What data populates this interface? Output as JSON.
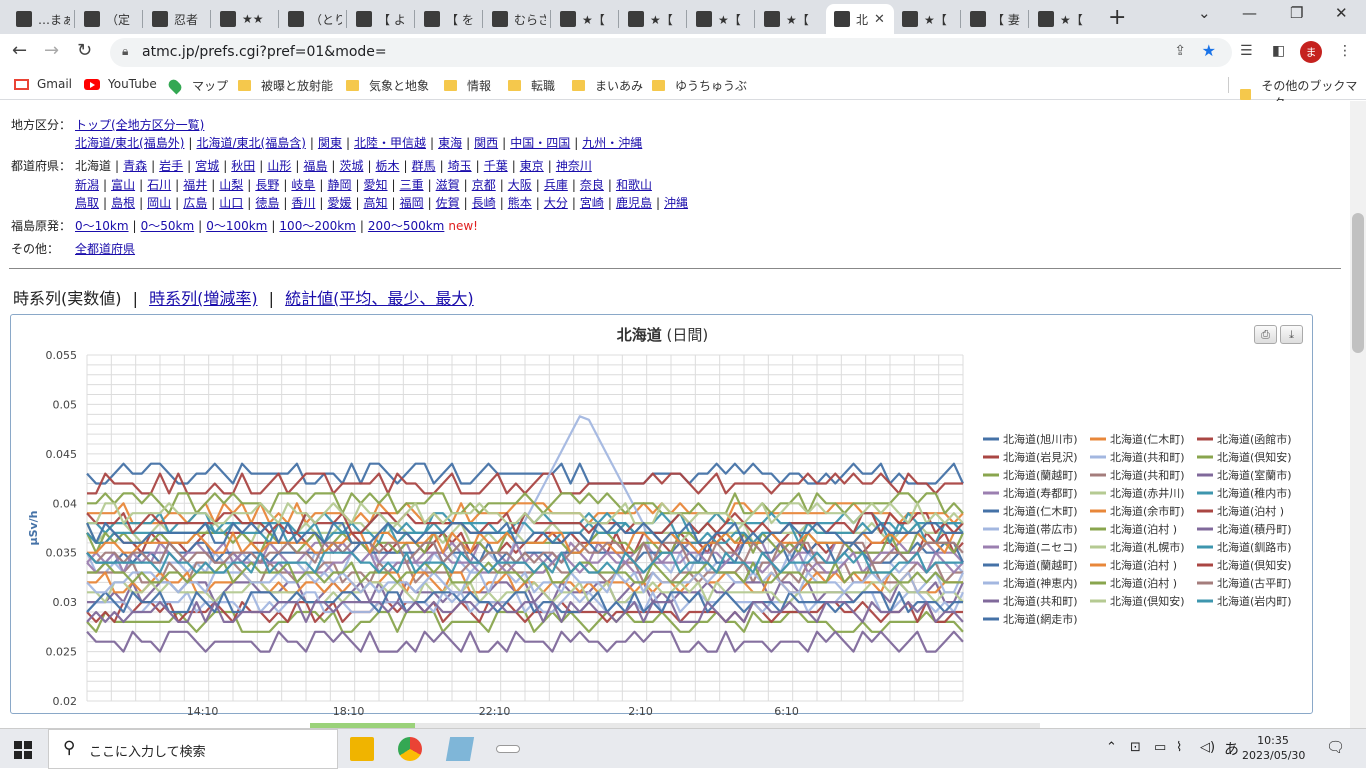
{
  "browser": {
    "tabs": [
      {
        "label": "…まぁ",
        "active": false
      },
      {
        "label": "（定",
        "active": false
      },
      {
        "label": "忍者",
        "active": false
      },
      {
        "label": "★★",
        "active": false
      },
      {
        "label": "（とり",
        "active": false
      },
      {
        "label": "【 よ",
        "active": false
      },
      {
        "label": "【 を",
        "active": false
      },
      {
        "label": "むらさ",
        "active": false
      },
      {
        "label": "★【",
        "active": false
      },
      {
        "label": "★【",
        "active": false
      },
      {
        "label": "★【",
        "active": false
      },
      {
        "label": "★【",
        "active": false
      },
      {
        "label": "北",
        "active": true
      },
      {
        "label": "★【",
        "active": false
      },
      {
        "label": "【 妻",
        "active": false
      },
      {
        "label": "★【",
        "active": false
      }
    ],
    "url": "atmc.jp/prefs.cgi?pref=01&mode=",
    "avatar_initial": "ま",
    "bookmarks": [
      "Gmail",
      "YouTube",
      "マップ",
      "被曝と放射能",
      "気象と地象",
      "情報",
      "転職",
      "まいあみ",
      "ゆうちゅうぶ"
    ],
    "other_bookmarks": "その他のブックマーク"
  },
  "page": {
    "nav": [
      {
        "label": "地方区分：",
        "lines": [
          [
            {
              "text": "トップ(全地方区分一覧)",
              "link": true
            }
          ],
          [
            {
              "text": "北海道/東北(福島外)",
              "link": true
            },
            {
              "text": "北海道/東北(福島含)",
              "link": true
            },
            {
              "text": "関東",
              "link": true
            },
            {
              "text": "北陸・甲信越",
              "link": true
            },
            {
              "text": "東海",
              "link": true
            },
            {
              "text": "関西",
              "link": true
            },
            {
              "text": "中国・四国",
              "link": true
            },
            {
              "text": "九州・沖縄",
              "link": true
            }
          ]
        ]
      },
      {
        "label": "都道府県：",
        "lines": [
          [
            {
              "text": "北海道",
              "link": false
            },
            {
              "text": "青森",
              "link": true
            },
            {
              "text": "岩手",
              "link": true
            },
            {
              "text": "宮城",
              "link": true
            },
            {
              "text": "秋田",
              "link": true
            },
            {
              "text": "山形",
              "link": true
            },
            {
              "text": "福島",
              "link": true
            },
            {
              "text": "茨城",
              "link": true
            },
            {
              "text": "栃木",
              "link": true
            },
            {
              "text": "群馬",
              "link": true
            },
            {
              "text": "埼玉",
              "link": true
            },
            {
              "text": "千葉",
              "link": true
            },
            {
              "text": "東京",
              "link": true
            },
            {
              "text": "神奈川",
              "link": true
            }
          ],
          [
            {
              "text": "新潟",
              "link": true
            },
            {
              "text": "富山",
              "link": true
            },
            {
              "text": "石川",
              "link": true
            },
            {
              "text": "福井",
              "link": true
            },
            {
              "text": "山梨",
              "link": true
            },
            {
              "text": "長野",
              "link": true
            },
            {
              "text": "岐阜",
              "link": true
            },
            {
              "text": "静岡",
              "link": true
            },
            {
              "text": "愛知",
              "link": true
            },
            {
              "text": "三重",
              "link": true
            },
            {
              "text": "滋賀",
              "link": true
            },
            {
              "text": "京都",
              "link": true
            },
            {
              "text": "大阪",
              "link": true
            },
            {
              "text": "兵庫",
              "link": true
            },
            {
              "text": "奈良",
              "link": true
            },
            {
              "text": "和歌山",
              "link": true
            }
          ],
          [
            {
              "text": "鳥取",
              "link": true
            },
            {
              "text": "島根",
              "link": true
            },
            {
              "text": "岡山",
              "link": true
            },
            {
              "text": "広島",
              "link": true
            },
            {
              "text": "山口",
              "link": true
            },
            {
              "text": "徳島",
              "link": true
            },
            {
              "text": "香川",
              "link": true
            },
            {
              "text": "愛媛",
              "link": true
            },
            {
              "text": "高知",
              "link": true
            },
            {
              "text": "福岡",
              "link": true
            },
            {
              "text": "佐賀",
              "link": true
            },
            {
              "text": "長崎",
              "link": true
            },
            {
              "text": "熊本",
              "link": true
            },
            {
              "text": "大分",
              "link": true
            },
            {
              "text": "宮崎",
              "link": true
            },
            {
              "text": "鹿児島",
              "link": true
            },
            {
              "text": "沖縄",
              "link": true
            }
          ]
        ]
      },
      {
        "label": "福島原発：",
        "lines": [
          [
            {
              "text": "0〜10km",
              "link": true
            },
            {
              "text": "0〜50km",
              "link": true
            },
            {
              "text": "0〜100km",
              "link": true
            },
            {
              "text": "100〜200km",
              "link": true
            },
            {
              "text": "200〜500km",
              "link": true
            }
          ]
        ],
        "new_label": "new!"
      },
      {
        "label": "その他：",
        "lines": [
          [
            {
              "text": "全都道府県",
              "link": true
            }
          ]
        ]
      }
    ],
    "views": {
      "current": "時系列(実数値)",
      "sep": "|",
      "link1": "時系列(増減率)",
      "link2": "統計値(平均、最少、最大)"
    }
  },
  "chart_data": {
    "type": "line",
    "title": "北海道",
    "subtitle": "(日間)",
    "ylabel": "μSv/h",
    "ylim": [
      0.02,
      0.055
    ],
    "yticks": [
      "0.055",
      "0.05",
      "0.045",
      "0.04",
      "0.035",
      "0.03",
      "0.025",
      "0.02"
    ],
    "xtick_labels": [
      "14:10",
      "18:10",
      "22:10",
      "2:10",
      "6:10"
    ],
    "x_range_hours": [
      11.0,
      35.0
    ],
    "series": [
      {
        "name": "北海道(旭川市)",
        "color": "#4572a7",
        "base": 0.043
      },
      {
        "name": "北海道(仁木町)",
        "color": "#e8873a",
        "base": 0.039
      },
      {
        "name": "北海道(函館市)",
        "color": "#aa4643",
        "base": 0.042
      },
      {
        "name": "北海道(岩見沢)",
        "color": "#aa4643",
        "base": 0.036
      },
      {
        "name": "北海道(共和町)",
        "color": "#a3b7e0",
        "base": 0.034,
        "bump": true
      },
      {
        "name": "北海道(倶知安)",
        "color": "#89a54e",
        "base": 0.04
      },
      {
        "name": "北海道(蘭越町)",
        "color": "#89a54e",
        "base": 0.028
      },
      {
        "name": "北海道(共和町)",
        "color": "#a47d7c",
        "base": 0.033
      },
      {
        "name": "北海道(室蘭市)",
        "color": "#80699b",
        "base": 0.031
      },
      {
        "name": "北海道(寿都町)",
        "color": "#9b7fb0",
        "base": 0.035
      },
      {
        "name": "北海道(赤井川)",
        "color": "#b5ca92",
        "base": 0.037
      },
      {
        "name": "北海道(稚内市)",
        "color": "#3d96ae",
        "base": 0.038
      },
      {
        "name": "北海道(仁木町)",
        "color": "#4572a7",
        "base": 0.035
      },
      {
        "name": "北海道(余市町)",
        "color": "#e8873a",
        "base": 0.032
      },
      {
        "name": "北海道(泊村 )",
        "color": "#aa4643",
        "base": 0.029
      },
      {
        "name": "北海道(帯広市)",
        "color": "#a3b7e0",
        "base": 0.03
      },
      {
        "name": "北海道(泊村 )",
        "color": "#89a54e",
        "base": 0.036
      },
      {
        "name": "北海道(積丹町)",
        "color": "#80699b",
        "base": 0.026
      },
      {
        "name": "北海道(ニセコ)",
        "color": "#9b7fb0",
        "base": 0.034
      },
      {
        "name": "北海道(札幌市)",
        "color": "#b5ca92",
        "base": 0.031
      },
      {
        "name": "北海道(釧路市)",
        "color": "#3d96ae",
        "base": 0.037
      },
      {
        "name": "北海道(蘭越町)",
        "color": "#4572a7",
        "base": 0.03
      },
      {
        "name": "北海道(泊村 )",
        "color": "#e8873a",
        "base": 0.036
      },
      {
        "name": "北海道(倶知安)",
        "color": "#aa4643",
        "base": 0.038
      },
      {
        "name": "北海道(神恵内)",
        "color": "#a3b7e0",
        "base": 0.032
      },
      {
        "name": "北海道(泊村 )",
        "color": "#89a54e",
        "base": 0.033
      },
      {
        "name": "北海道(古平町)",
        "color": "#a47d7c",
        "base": 0.035
      },
      {
        "name": "北海道(共和町)",
        "color": "#80699b",
        "base": 0.029
      },
      {
        "name": "北海道(倶知安)",
        "color": "#b5ca92",
        "base": 0.039
      },
      {
        "name": "北海道(岩内町)",
        "color": "#3d96ae",
        "base": 0.034
      },
      {
        "name": "北海道(網走市)",
        "color": "#4572a7",
        "base": 0.037
      }
    ]
  },
  "taskbar": {
    "search_placeholder": "ここに入力して検索",
    "time": "10:35",
    "date": "2023/05/30",
    "ime": "あ"
  }
}
